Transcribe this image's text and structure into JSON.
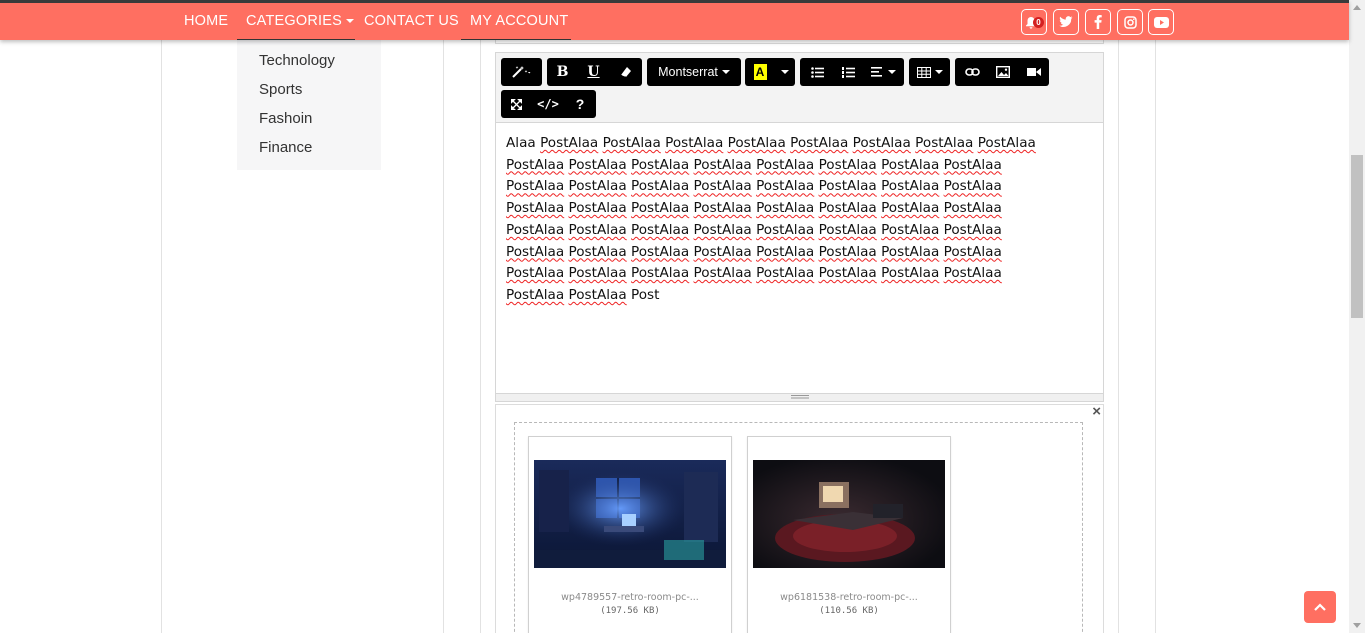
{
  "nav": {
    "home": "HOME",
    "categories": "CATEGORIES",
    "contact": "CONTACT US",
    "account": "MY ACCOUNT",
    "notification_count": "0",
    "icons": [
      "bell-icon",
      "twitter-icon",
      "facebook-icon",
      "instagram-icon",
      "youtube-icon"
    ]
  },
  "categories_menu": [
    "Technology",
    "Sports",
    "Fashoin",
    "Finance"
  ],
  "editor": {
    "font_name": "Montserrat",
    "lines": [
      [
        "Alaa",
        "PostAlaa",
        "PostAlaa",
        "PostAlaa",
        "PostAlaa",
        "PostAlaa",
        "PostAlaa",
        "PostAlaa",
        "PostAlaa"
      ],
      [
        "PostAlaa",
        "PostAlaa",
        "PostAlaa",
        "PostAlaa",
        "PostAlaa",
        "PostAlaa",
        "PostAlaa",
        "PostAlaa"
      ],
      [
        "PostAlaa",
        "PostAlaa",
        "PostAlaa",
        "PostAlaa",
        "PostAlaa",
        "PostAlaa",
        "PostAlaa",
        "PostAlaa"
      ],
      [
        "PostAlaa",
        "PostAlaa",
        "PostAlaa",
        "PostAlaa",
        "PostAlaa",
        "PostAlaa",
        "PostAlaa",
        "PostAlaa"
      ],
      [
        "PostAlaa",
        "PostAlaa",
        "PostAlaa",
        "PostAlaa",
        "PostAlaa",
        "PostAlaa",
        "PostAlaa",
        "PostAlaa"
      ],
      [
        "PostAlaa",
        "PostAlaa",
        "PostAlaa",
        "PostAlaa",
        "PostAlaa",
        "PostAlaa",
        "PostAlaa",
        "PostAlaa"
      ],
      [
        "PostAlaa",
        "PostAlaa",
        "PostAlaa",
        "PostAlaa",
        "PostAlaa",
        "PostAlaa",
        "PostAlaa",
        "PostAlaa"
      ],
      [
        "PostAlaa",
        "PostAlaa",
        "Post"
      ]
    ]
  },
  "upload": {
    "remove_symbol": "×",
    "files": [
      {
        "name": "wp4789557-retro-room-pc-...",
        "size": "(197.56 KB)"
      },
      {
        "name": "wp6181538-retro-room-pc-...",
        "size": "(110.56 KB)"
      }
    ]
  },
  "colors": {
    "accent": "#ff6f61",
    "toolbar_button": "#000000"
  }
}
